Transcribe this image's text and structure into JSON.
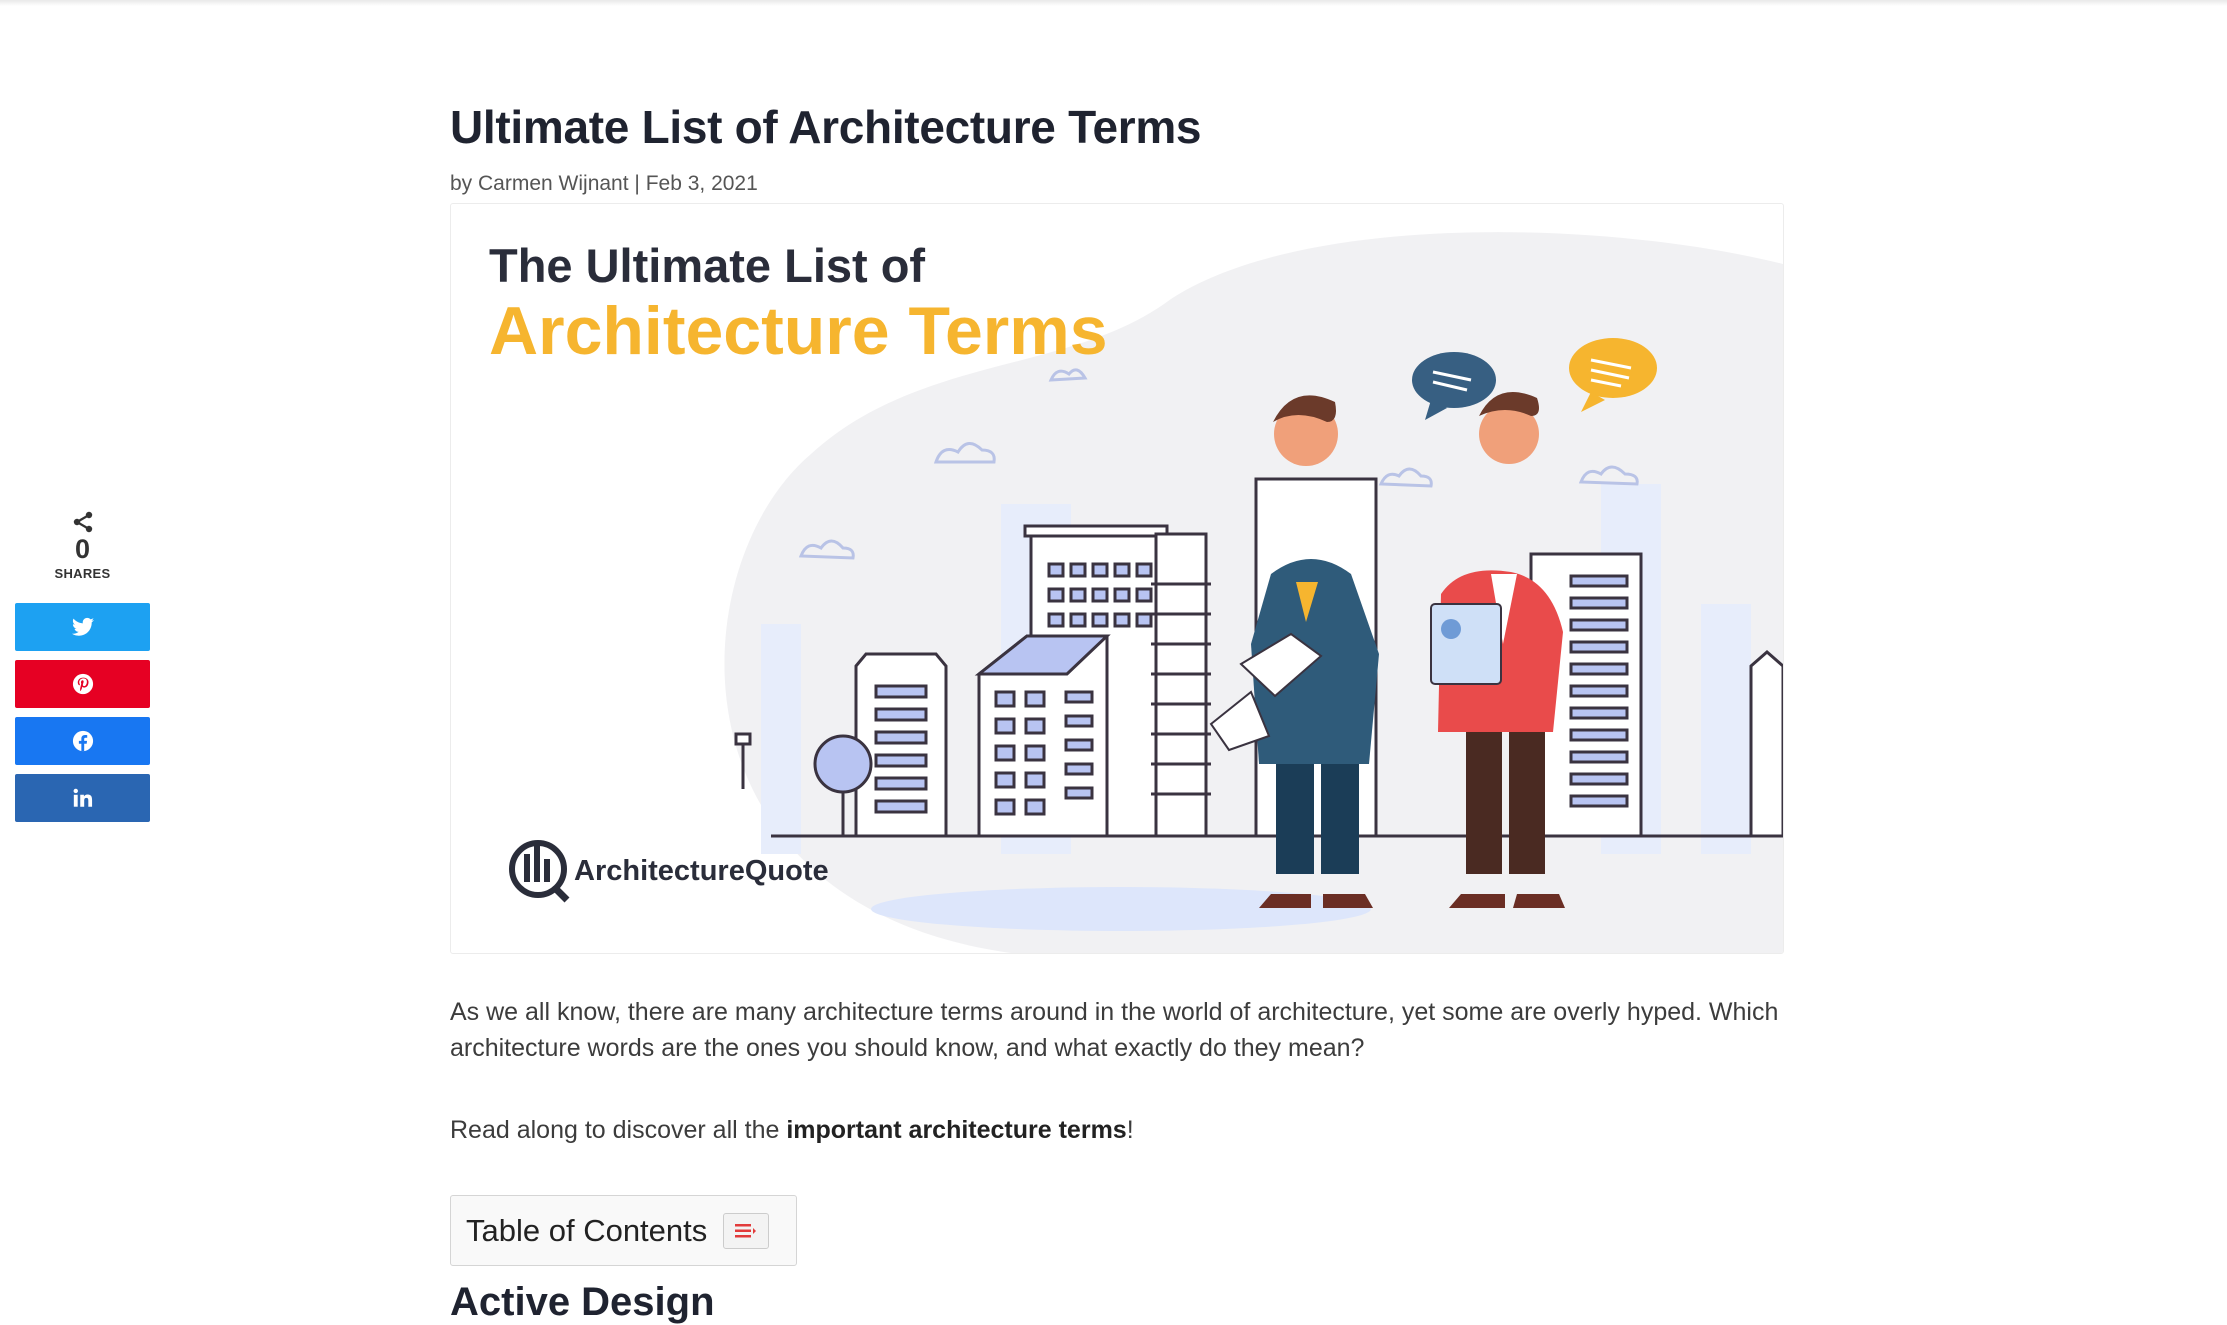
{
  "article": {
    "title": "Ultimate List of Architecture Terms",
    "meta_prefix": "by ",
    "author": "Carmen Wijnant",
    "separator": " | ",
    "date": "Feb 3, 2021",
    "intro": "As we all know, there are many architecture terms around in the world of architecture, yet some are overly hyped. Which architecture words are the ones you should know, and what exactly do they mean?",
    "p2_before": "Read along to discover all the ",
    "p2_bold": "important architecture terms",
    "p2_after": "!",
    "toc_title": "Table of Contents",
    "next_heading": "Active Design"
  },
  "hero": {
    "line1": "The Ultimate List of",
    "line2": "Architecture Terms",
    "brand": "ArchitectureQuote",
    "accent": "#f6b52f",
    "dark": "#2a2d3a"
  },
  "share": {
    "count": "0",
    "label": "SHARES",
    "buttons": [
      {
        "network": "twitter",
        "icon": "twitter-icon",
        "color": "#1da1f2"
      },
      {
        "network": "pinterest",
        "icon": "pinterest-icon",
        "color": "#e60023"
      },
      {
        "network": "facebook",
        "icon": "facebook-icon",
        "color": "#1877f2"
      },
      {
        "network": "linkedin",
        "icon": "linkedin-icon",
        "color": "#2a66b2"
      }
    ]
  }
}
